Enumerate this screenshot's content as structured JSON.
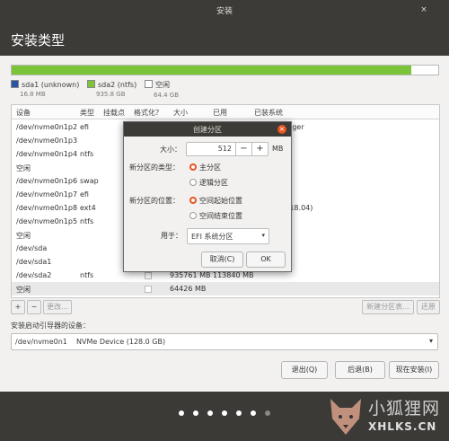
{
  "window": {
    "title": "安装",
    "close": "×"
  },
  "header": {
    "title": "安装类型"
  },
  "colors": {
    "sda1": "#2a55a5",
    "sda2": "#7bc43a",
    "free": "#ffffff"
  },
  "legend": [
    {
      "name": "sda1 (unknown)",
      "size": "16.8 MB"
    },
    {
      "name": "sda2 (ntfs)",
      "size": "935.8 GB"
    },
    {
      "name": "空闲",
      "size": "64.4 GB"
    }
  ],
  "table": {
    "headers": [
      "设备",
      "类型",
      "挂载点",
      "格式化？",
      "大小",
      "已用",
      "已装系统"
    ],
    "rows": [
      {
        "device": "/dev/nvme0n1p2",
        "type": "efi",
        "size": "",
        "used": "",
        "system": "boot Manager"
      },
      {
        "device": "/dev/nvme0n1p3",
        "type": "",
        "size": "",
        "used": "",
        "system": ""
      },
      {
        "device": "/dev/nvme0n1p4",
        "type": "ntfs",
        "size": "",
        "used": "",
        "system": ""
      },
      {
        "device": "空闲",
        "type": "",
        "size": "",
        "used": "",
        "system": ""
      },
      {
        "device": "/dev/nvme0n1p6",
        "type": "swap",
        "size": "",
        "used": "",
        "system": ""
      },
      {
        "device": "/dev/nvme0n1p7",
        "type": "efi",
        "size": "",
        "used": "",
        "system": ""
      },
      {
        "device": "/dev/nvme0n1p8",
        "type": "ext4",
        "size": "",
        "used": "",
        "system": "04.1 LTS (18.04)"
      },
      {
        "device": "/dev/nvme0n1p5",
        "type": "ntfs",
        "size": "",
        "used": "",
        "system": ""
      },
      {
        "device": "空闲",
        "type": "",
        "size": "",
        "used": "",
        "system": ""
      },
      {
        "device": "/dev/sda",
        "type": "",
        "size": "",
        "used": "",
        "system": ""
      },
      {
        "device": "/dev/sda1",
        "type": "",
        "size": "",
        "used": "",
        "system": ""
      },
      {
        "device": "/dev/sda2",
        "type": "ntfs",
        "size": "935761 MB",
        "used": "113840 MB",
        "system": ""
      },
      {
        "device": "空闲",
        "type": "",
        "size": "64426 MB",
        "used": "",
        "system": ""
      }
    ]
  },
  "table_buttons": {
    "add": "+",
    "remove": "−",
    "change": "更改...",
    "new_table": "新建分区表...",
    "revert": "还原"
  },
  "boot": {
    "label": "安装启动引导器的设备：",
    "value": "/dev/nvme0n1",
    "desc": "NVMe Device (128.0 GB)",
    "arrow": "▾"
  },
  "nav": {
    "quit": "退出(Q)",
    "back": "后退(B)",
    "install": "现在安装(I)"
  },
  "dialog": {
    "title": "创建分区",
    "close": "×",
    "size_label": "大小：",
    "size_value": "512",
    "size_unit": "MB",
    "minus": "−",
    "plus": "+",
    "type_label": "新分区的类型：",
    "type_primary": "主分区",
    "type_logical": "逻辑分区",
    "loc_label": "新分区的位置：",
    "loc_start": "空间起始位置",
    "loc_end": "空间结束位置",
    "use_label": "用于：",
    "use_value": "EFI 系统分区",
    "use_arrow": "▾",
    "cancel": "取消(C)",
    "ok": "OK"
  },
  "watermark": {
    "cn": "小狐狸网",
    "en": "XHLKS.CN"
  },
  "progress": {
    "sda1_fraction": 0.0,
    "sda2_fraction": 0.936,
    "free_fraction": 0.064
  }
}
